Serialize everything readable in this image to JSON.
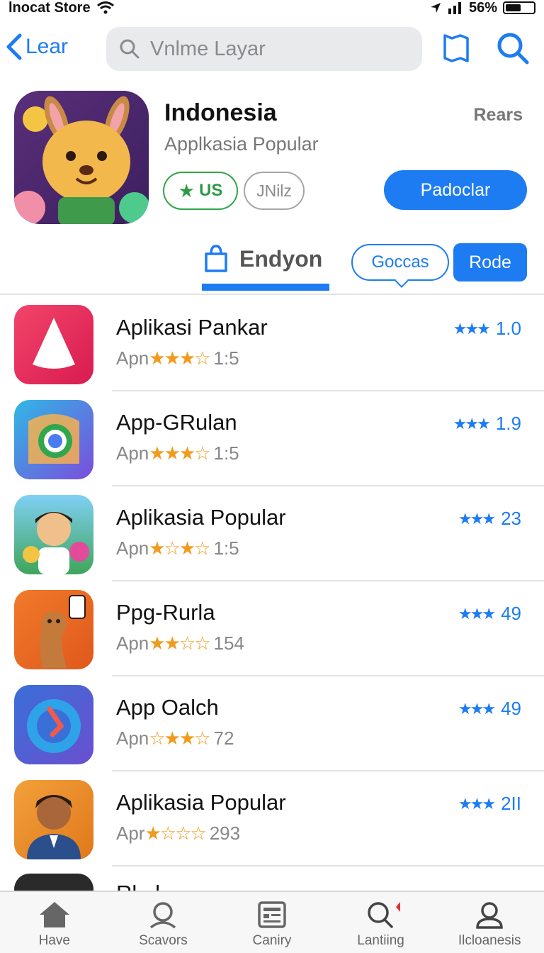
{
  "status_bar": {
    "carrier": "lnocat Store",
    "battery": "56%",
    "battery_level": 0.56
  },
  "nav": {
    "back_label": "Lear",
    "search_placeholder": "Vnlme Layar",
    "icons": {
      "back": "chevron-left-icon",
      "search_field": "search-icon",
      "bookmark": "bookmark-icon",
      "search": "search-icon"
    }
  },
  "app": {
    "title": "Indonesia",
    "subtitle": "Applkasia Popular",
    "rank_label": "Rears",
    "badge_primary": "US",
    "badge_secondary": "JNilz",
    "download_label": "Padoclar",
    "colors": {
      "accent": "#1d7cf2",
      "green": "#2fa74a"
    }
  },
  "tabs": {
    "main": "Endyon",
    "outline": "Goccas",
    "filled": "Rode"
  },
  "apps": [
    {
      "name": "Aplikasi Pankar",
      "sub_prefix": "Apn",
      "sub_stars": "★★★☆",
      "sub_value": "1:5",
      "right_stars": "★★★",
      "rating": "1.0"
    },
    {
      "name": "App-GRulan",
      "sub_prefix": "Apn",
      "sub_stars": "★★★☆",
      "sub_value": "1:5",
      "right_stars": "★★★",
      "rating": "1.9"
    },
    {
      "name": "Aplikasia Popular",
      "sub_prefix": "Apn",
      "sub_stars": "★☆★☆",
      "sub_value": "1:5",
      "right_stars": "★★★",
      "rating": "23"
    },
    {
      "name": "Ppg-Rurla",
      "sub_prefix": "Apn",
      "sub_stars": "★★☆☆",
      "sub_value": "154",
      "right_stars": "★★★",
      "rating": "49"
    },
    {
      "name": "App Oalch",
      "sub_prefix": "Apn",
      "sub_stars": "☆★★☆",
      "sub_value": "72",
      "right_stars": "★★★",
      "rating": "49"
    },
    {
      "name": "Aplikasia Popular",
      "sub_prefix": "Apr",
      "sub_stars": "★☆☆☆",
      "sub_value": "293",
      "right_stars": "★★★",
      "rating": "2II"
    }
  ],
  "partial_item": {
    "name": "Rl...l"
  },
  "bottom_tabs": [
    {
      "label": "Have",
      "icon": "home-icon"
    },
    {
      "label": "Scavors",
      "icon": "person-icon"
    },
    {
      "label": "Caniry",
      "icon": "list-card-icon"
    },
    {
      "label": "Lantiing",
      "icon": "search-icon"
    },
    {
      "label": "Ilcloanesis",
      "icon": "profile-icon"
    }
  ]
}
